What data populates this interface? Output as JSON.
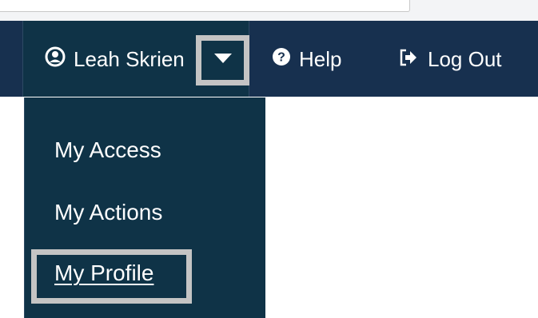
{
  "colors": {
    "navbar_bg": "#17304f",
    "user_menu_bg": "#0f3347",
    "text": "#ffffff",
    "highlight_border": "#c4c4c4"
  },
  "nav": {
    "user": {
      "icon": "user-circle-icon",
      "label": "Leah Skrien"
    },
    "dropdown_toggle": {
      "icon": "caret-down-icon"
    },
    "help": {
      "icon": "question-circle-icon",
      "label": "Help"
    },
    "logout": {
      "icon": "sign-out-icon",
      "label": "Log Out"
    }
  },
  "user_menu": {
    "items": [
      {
        "label": "My Access"
      },
      {
        "label": "My Actions"
      },
      {
        "label": "My Profile",
        "highlighted": true
      }
    ]
  }
}
